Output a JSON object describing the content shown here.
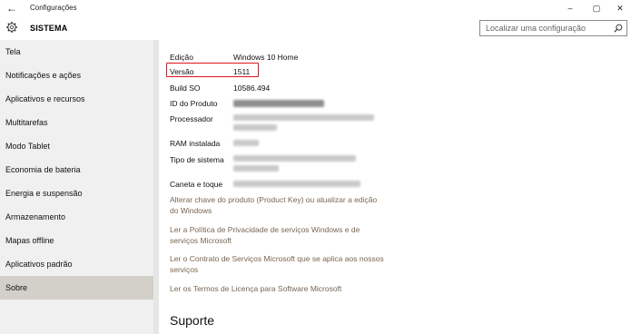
{
  "window": {
    "title": "Configurações",
    "controls": [
      "–",
      "▢",
      "✕"
    ]
  },
  "header": {
    "section": "SISTEMA",
    "search_placeholder": "Localizar uma configuração"
  },
  "sidebar": {
    "items": [
      {
        "label": "Tela"
      },
      {
        "label": "Notificações e ações"
      },
      {
        "label": "Aplicativos e recursos"
      },
      {
        "label": "Multitarefas"
      },
      {
        "label": "Modo Tablet"
      },
      {
        "label": "Economia de bateria"
      },
      {
        "label": "Energia e suspensão"
      },
      {
        "label": "Armazenamento"
      },
      {
        "label": "Mapas offline"
      },
      {
        "label": "Aplicativos padrão"
      },
      {
        "label": "Sobre"
      }
    ],
    "selected": "Sobre"
  },
  "about": {
    "edition_label": "Edição",
    "edition_value": "Windows 10 Home",
    "version_label": "Versão",
    "version_value": "1511",
    "build_label": "Build SO",
    "build_value": "10586.494",
    "product_id_label": "ID do Produto",
    "processor_label": "Processador",
    "ram_label": "RAM instalada",
    "system_type_label": "Tipo de sistema",
    "pen_touch_label": "Caneta e toque"
  },
  "links": {
    "change_key": "Alterar chave do produto (Product Key) ou atualizar a edição do Windows",
    "privacy": "Ler a Política de Privacidade de serviços Windows e de serviços Microsoft",
    "services_agreement": "Ler o Contrato de Serviços Microsoft que se aplica aos nossos serviços",
    "license_terms": "Ler os Termos de Licença para Software Microsoft"
  },
  "support_heading": "Suporte",
  "accent_colors": {
    "highlight_border": "#e0141e",
    "link": "#7a6552",
    "sidebar_selected": "#d3cfc9"
  }
}
